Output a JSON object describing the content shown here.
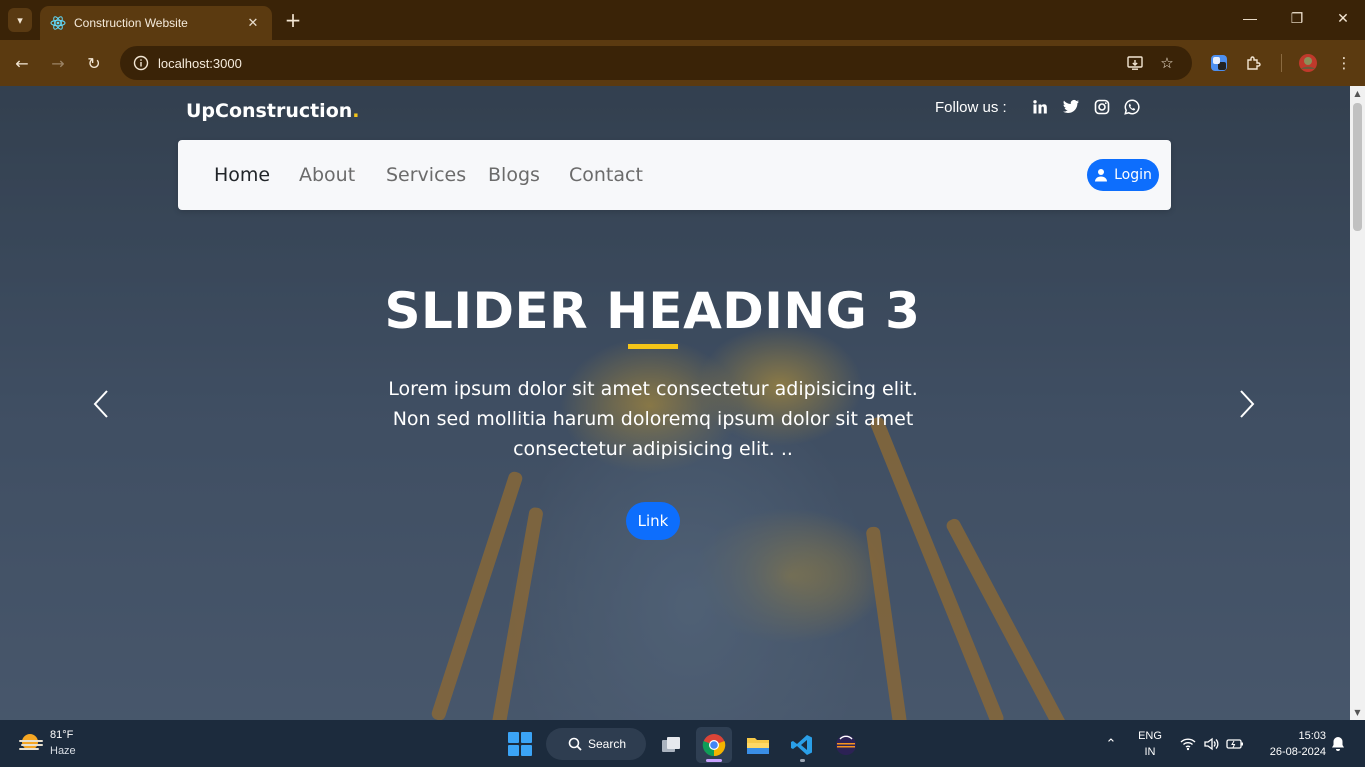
{
  "browser": {
    "tab_title": "Construction Website",
    "tab_close": "✕",
    "new_tab": "+",
    "url": "localhost:3000",
    "window_controls": {
      "minimize": "—",
      "restore": "❐",
      "close": "✕"
    }
  },
  "header": {
    "brand": "UpConstruction",
    "brand_dot": ".",
    "follow_label": "Follow us :",
    "social_icons": [
      "linkedin-icon",
      "twitter-icon",
      "instagram-icon",
      "whatsapp-icon"
    ]
  },
  "navbar": {
    "links": [
      "Home",
      "About",
      "Services",
      "Blogs",
      "Contact"
    ],
    "active_link": "Home",
    "login_label": "Login"
  },
  "hero": {
    "heading": "SLIDER HEADING 3",
    "text": "Lorem ipsum dolor sit amet consectetur adipisicing elit. Non sed mollitia harum doloremq ipsum dolor sit amet consectetur adipisicing elit. ..",
    "link_label": "Link"
  },
  "taskbar": {
    "weather_temp": "81°F",
    "weather_desc": "Haze",
    "search_label": "Search",
    "lang_line1": "ENG",
    "lang_line2": "IN",
    "time": "15:03",
    "date": "26-08-2024"
  },
  "colors": {
    "accent_yellow": "#f5c518",
    "primary_blue": "#0d6efd",
    "chrome_dark": "#3a2307",
    "chrome_mid": "#5b3a10",
    "taskbar": "#1c2b3d"
  }
}
